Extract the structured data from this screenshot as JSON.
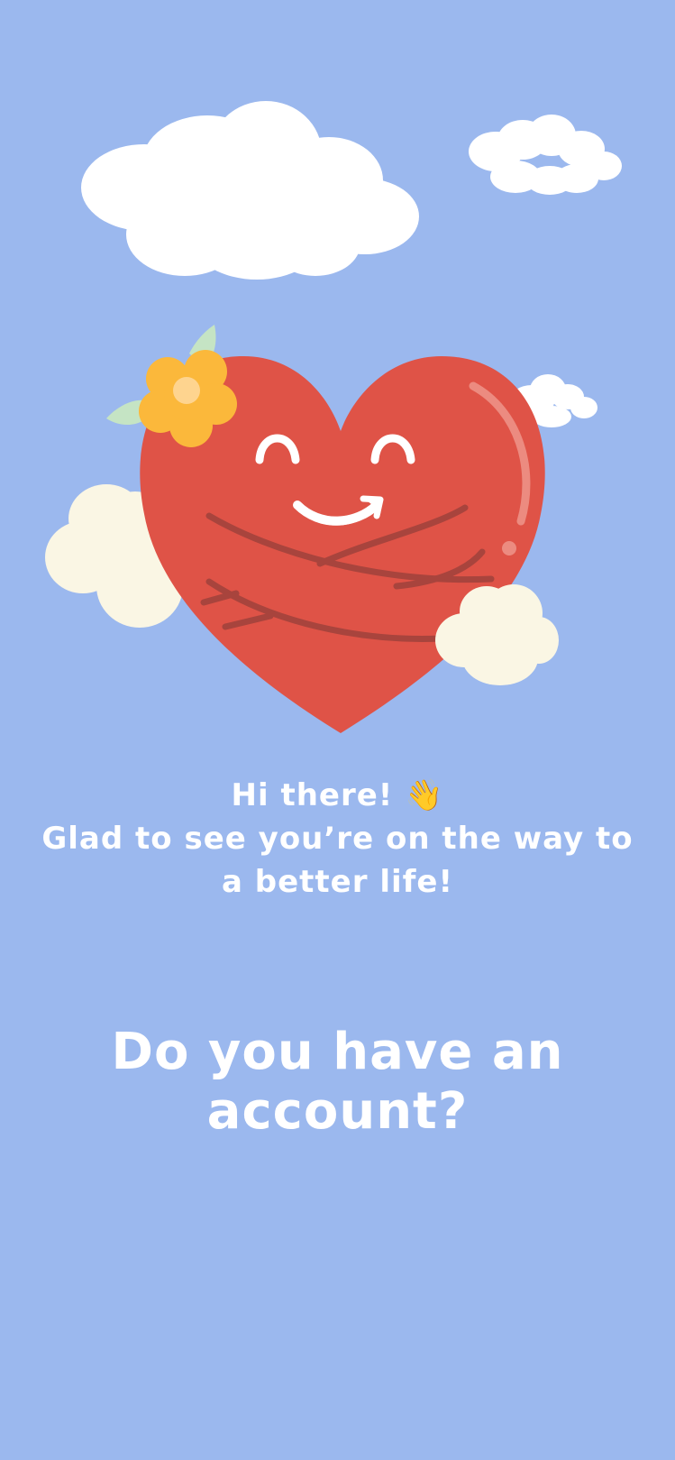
{
  "greeting": {
    "line1": "Hi there!",
    "wave_emoji": "👋",
    "line2": "Glad to see you’re on the way to",
    "line3": "a better life!"
  },
  "question": {
    "line1": "Do you have an",
    "line2": "account?"
  },
  "illustration": {
    "icon": "hugging-heart-icon",
    "heart_color": "#df5347",
    "flower_color": "#fbb83b",
    "cloud_color": "#ffffff",
    "cream_cloud_color": "#faf6e4"
  },
  "colors": {
    "background": "#9bb8ee",
    "text": "#ffffff"
  }
}
